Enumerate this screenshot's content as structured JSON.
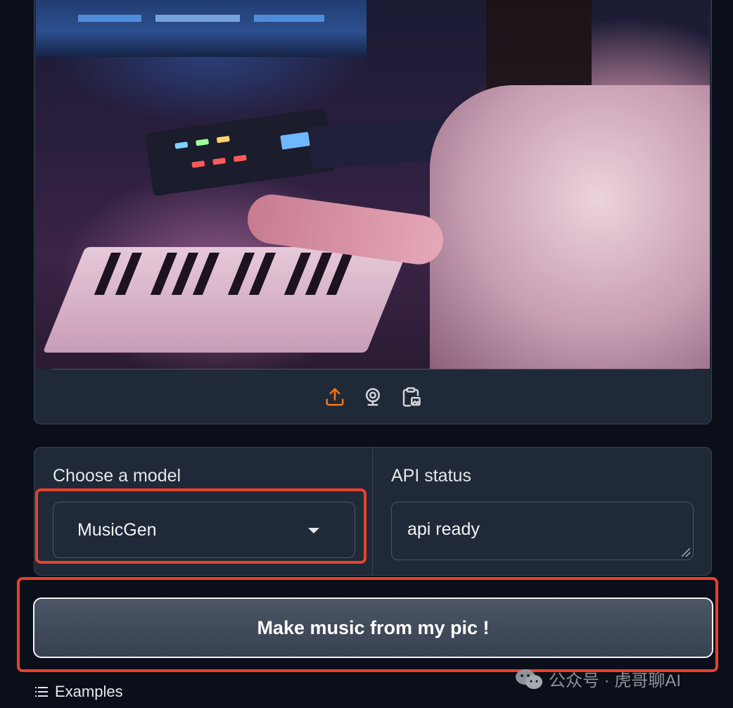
{
  "image_panel": {
    "photo_description_icon": "image",
    "toolbar": [
      {
        "icon": "upload-icon",
        "color": "#f97316"
      },
      {
        "icon": "webcam-icon",
        "color": "#d1d5db"
      },
      {
        "icon": "clipboard-paste-icon",
        "color": "#d1d5db"
      }
    ]
  },
  "model_selector": {
    "label": "Choose a model",
    "selected": "MusicGen"
  },
  "api_status": {
    "label": "API status",
    "value": "api ready"
  },
  "action": {
    "button_label": "Make music from my pic !"
  },
  "examples": {
    "label": "Examples"
  },
  "watermark": {
    "text": "公众号 · 虎哥聊AI"
  },
  "colors": {
    "background": "#0b0f19",
    "panel": "#1f2937",
    "border": "#374151",
    "highlight": "#e8412c",
    "accent": "#f97316"
  }
}
